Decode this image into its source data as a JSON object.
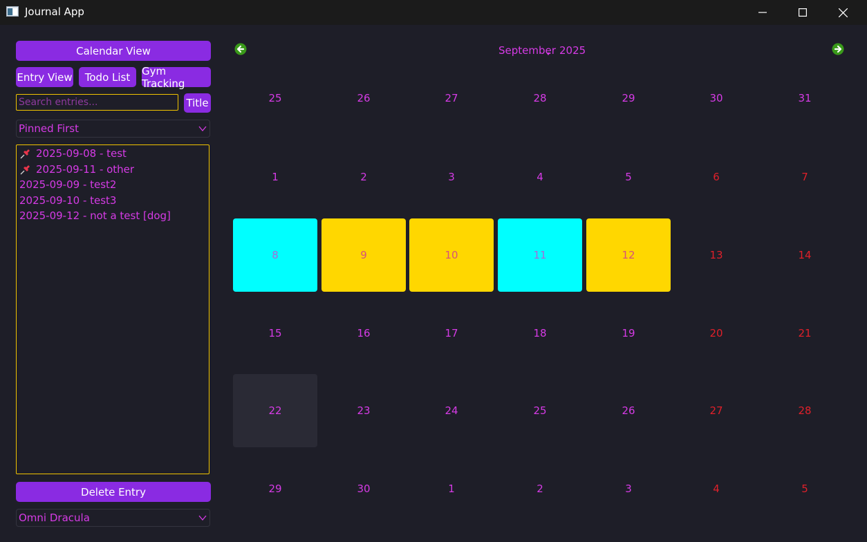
{
  "window": {
    "title": "Journal App",
    "minimize_icon": "minimize-icon",
    "maximize_icon": "maximize-icon",
    "close_icon": "close-icon"
  },
  "sidebar": {
    "calendar_view": "Calendar View",
    "entry_view": "Entry View",
    "todo_list": "Todo List",
    "gym_tracking": "Gym Tracking",
    "search_placeholder": "Search entries...",
    "search_mode": "Title",
    "sort": "Pinned First",
    "entries": [
      {
        "label": "2025-09-08 - test",
        "pinned": true
      },
      {
        "label": "2025-09-11 - other",
        "pinned": true
      },
      {
        "label": "2025-09-09 - test2",
        "pinned": false
      },
      {
        "label": "2025-09-10 - test3",
        "pinned": false
      },
      {
        "label": "2025-09-12 - not a test [dog]",
        "pinned": false
      }
    ],
    "delete_entry": "Delete Entry",
    "theme": "Omni Dracula"
  },
  "calendar": {
    "month": "September",
    "year": "2025",
    "prev_icon": "arrow-left-icon",
    "next_icon": "arrow-right-icon",
    "weeks": [
      [
        "25",
        "26",
        "27",
        "28",
        "29",
        "30",
        "31"
      ],
      [
        "1",
        "2",
        "3",
        "4",
        "5",
        "6",
        "7"
      ],
      [
        "8",
        "9",
        "10",
        "11",
        "12",
        "13",
        "14"
      ],
      [
        "15",
        "16",
        "17",
        "18",
        "19",
        "20",
        "21"
      ],
      [
        "22",
        "23",
        "24",
        "25",
        "26",
        "27",
        "28"
      ],
      [
        "29",
        "30",
        "1",
        "2",
        "3",
        "4",
        "5"
      ]
    ],
    "highlights": {
      "8": "#00ffff",
      "9": "#ffd700",
      "10": "#ffd700",
      "11": "#00ffff",
      "12": "#ffd700",
      "22": "#2a2a35"
    },
    "colors": {
      "weekday": "#d63be6",
      "weekend": "#e0202a",
      "accent": "#8a2be2",
      "border": "#f2c500",
      "arrow": "#3a9a1a"
    }
  }
}
